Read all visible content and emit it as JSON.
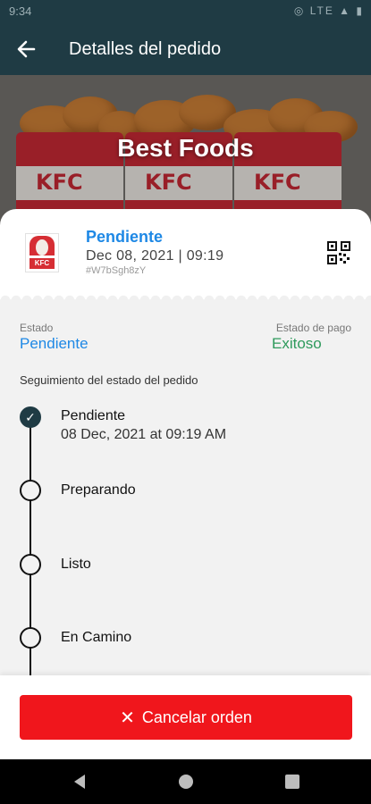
{
  "status_bar": {
    "time": "9:34",
    "icons": "◎ LTE ▲ ▮"
  },
  "header": {
    "title": "Detalles del pedido"
  },
  "hero": {
    "restaurant": "Best Foods"
  },
  "order": {
    "status": "Pendiente",
    "date": "Dec 08, 2021 | 09:19",
    "code": "#W7bSgh8zY",
    "logo_text": "KFC"
  },
  "summary": {
    "state_label": "Estado",
    "state_value": "Pendiente",
    "payment_label": "Estado de pago",
    "payment_value": "Exitoso"
  },
  "tracking": {
    "title": "Seguimiento del estado del pedido",
    "steps": [
      {
        "label": "Pendiente",
        "time": "08 Dec, 2021 at 09:19 AM",
        "done": true
      },
      {
        "label": "Preparando",
        "done": false
      },
      {
        "label": "Listo",
        "done": false
      },
      {
        "label": "En Camino",
        "done": false
      }
    ]
  },
  "actions": {
    "cancel_label": "Cancelar orden"
  },
  "colors": {
    "primary": "#1f3b44",
    "status_blue": "#1e88e5",
    "success_green": "#2e9a5c",
    "danger_red": "#f0161c"
  }
}
